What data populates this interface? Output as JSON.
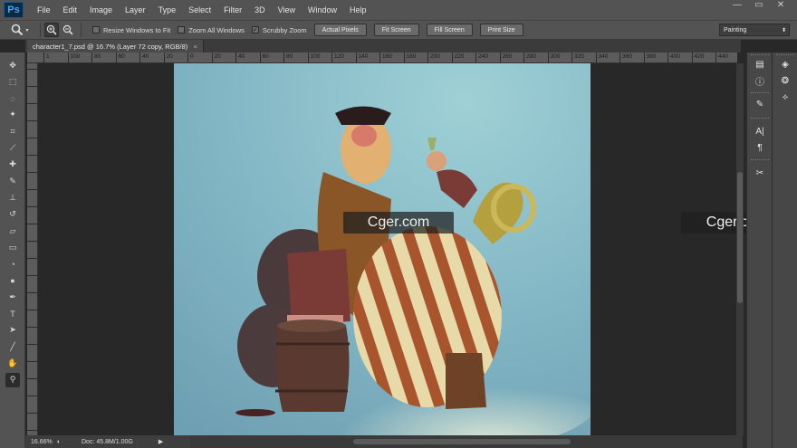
{
  "app": {
    "logo": "Ps"
  },
  "menu": [
    "File",
    "Edit",
    "Image",
    "Layer",
    "Type",
    "Select",
    "Filter",
    "3D",
    "View",
    "Window",
    "Help"
  ],
  "window_controls": [
    "—",
    "▭",
    "✕"
  ],
  "options_bar": {
    "tool_icon": "zoom-icon",
    "zoom_in": "+",
    "zoom_out": "−",
    "resize_windows": "Resize Windows to Fit",
    "zoom_all_windows": "Zoom All Windows",
    "scrubby_zoom": "Scrubby Zoom",
    "scrubby_checked": true,
    "buttons": [
      "Actual Pixels",
      "Fit Screen",
      "Fill Screen",
      "Print Size"
    ],
    "workspace": "Painting"
  },
  "document_tab": {
    "title": "character1_7.psd @ 16.7% (Layer 72 copy, RGB/8)"
  },
  "ruler": {
    "horizontal": [
      "100",
      "120",
      "140",
      "160",
      "180",
      "200",
      "220",
      "240",
      "260",
      "280",
      "300",
      "320",
      "340",
      "360",
      "380",
      "400",
      "420",
      "440"
    ],
    "h_labels": [
      "1",
      "100",
      "80",
      "60",
      "40",
      "20",
      "0",
      "20",
      "40",
      "60",
      "80",
      "100",
      "120",
      "140",
      "160",
      "180",
      "200",
      "220",
      "240",
      "260",
      "280",
      "300",
      "320",
      "340",
      "360",
      "380",
      "400",
      "420",
      "440"
    ]
  },
  "status_bar": {
    "zoom": "16.66%",
    "doc": "Doc: 45.8M/1.00G"
  },
  "colors": {
    "foreground": "#7aa83a",
    "background": "#111111",
    "accent": "#3ea8f5"
  },
  "watermark": "Cger.com",
  "tools": [
    "move-icon",
    "marquee-icon",
    "lasso-icon",
    "magic-wand-icon",
    "crop-icon",
    "eyedropper-icon",
    "healing-icon",
    "brush-icon",
    "clone-stamp-icon",
    "history-brush-icon",
    "eraser-icon",
    "gradient-icon",
    "blur-icon",
    "dodge-icon",
    "pen-icon",
    "type-icon",
    "path-select-icon",
    "shape-icon",
    "hand-icon",
    "zoom-icon"
  ],
  "right_panel_icons": [
    "history-icon",
    "info-icon",
    "brush-panel-icon",
    "character-icon",
    "paragraph-icon",
    "tools-preset-icon",
    "layers-icon",
    "channels-icon",
    "paths-icon"
  ]
}
